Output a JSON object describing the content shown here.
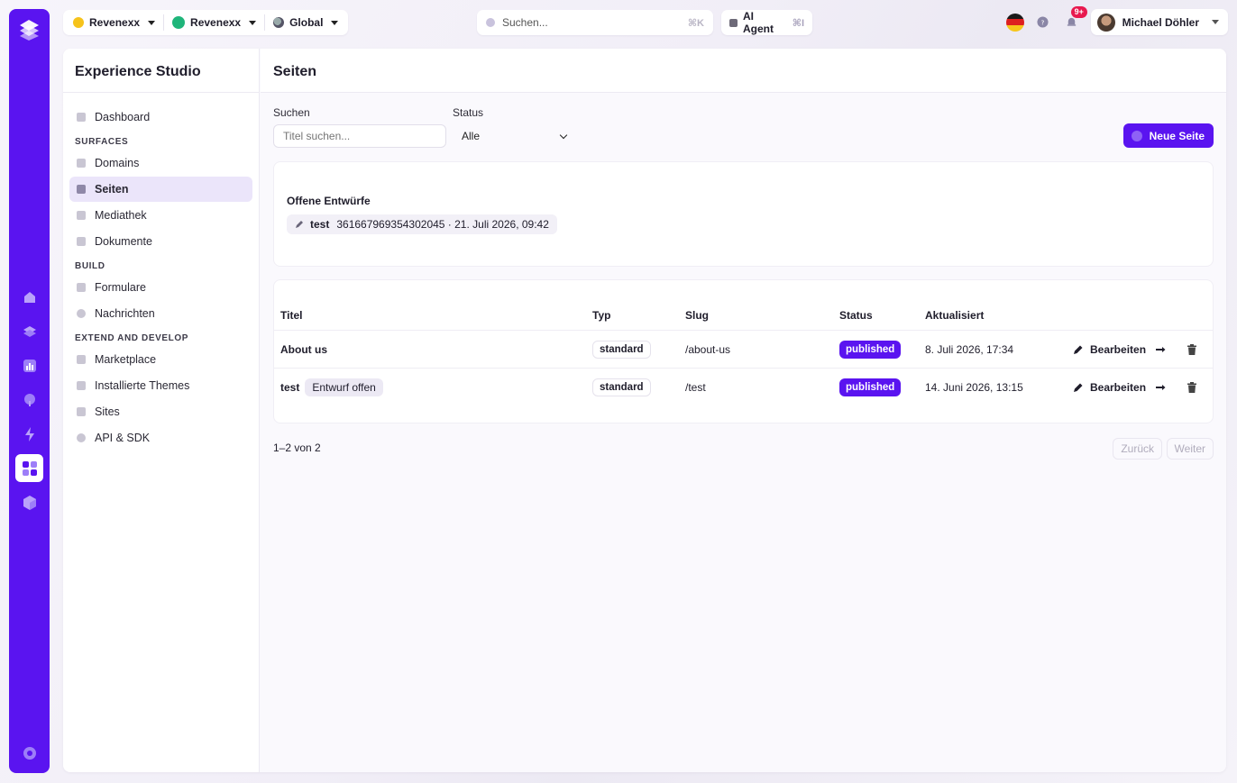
{
  "topbar": {
    "org_selector": "Revenexx",
    "workspace_selector": "Revenexx",
    "region_selector": "Global",
    "search_placeholder": "Suchen...",
    "search_shortcut": "⌘K",
    "ai_agent_label": "AI Agent",
    "ai_agent_shortcut": "⌘I",
    "notification_badge": "9+",
    "user_name": "Michael Döhler"
  },
  "sidebar": {
    "title": "Experience Studio",
    "dashboard": "Dashboard",
    "sections": [
      {
        "heading": "SURFACES",
        "items": [
          "Domains",
          "Seiten",
          "Mediathek",
          "Dokumente"
        ]
      },
      {
        "heading": "BUILD",
        "items": [
          "Formulare",
          "Nachrichten"
        ]
      },
      {
        "heading": "EXTEND AND DEVELOP",
        "items": [
          "Marketplace",
          "Installierte Themes",
          "Sites",
          "API & SDK"
        ]
      }
    ],
    "active_item": "Seiten"
  },
  "page": {
    "title": "Seiten",
    "search_label": "Suchen",
    "search_placeholder": "Titel suchen...",
    "status_label": "Status",
    "status_value": "Alle",
    "new_button": "Neue Seite"
  },
  "drafts": {
    "title": "Offene Entwürfe",
    "items": [
      {
        "name": "test",
        "meta": "361667969354302045 · 21. Juli 2026, 09:42"
      }
    ]
  },
  "table": {
    "columns": [
      "Titel",
      "Typ",
      "Slug",
      "Status",
      "Aktualisiert"
    ],
    "rows": [
      {
        "title": "About us",
        "draft_tag": "",
        "type": "standard",
        "slug": "/about-us",
        "status": "published",
        "updated": "8. Juli 2026, 17:34",
        "edit_label": "Bearbeiten"
      },
      {
        "title": "test",
        "draft_tag": "Entwurf offen",
        "type": "standard",
        "slug": "/test",
        "status": "published",
        "updated": "14. Juni 2026, 13:15",
        "edit_label": "Bearbeiten"
      }
    ]
  },
  "pager": {
    "summary": "1–2 von 2",
    "prev": "Zurück",
    "next": "Weiter"
  },
  "colors": {
    "brand": "#5a14f0",
    "badge": "#e8194f",
    "workspace_dot": "#1fb57a"
  }
}
